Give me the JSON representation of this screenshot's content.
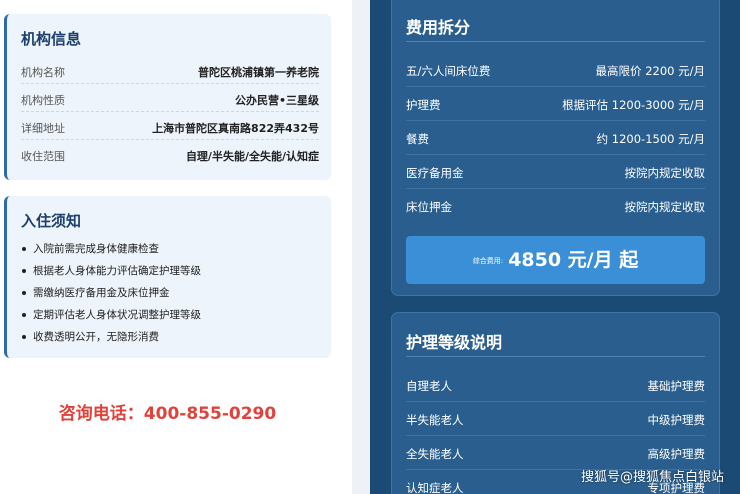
{
  "org_info": {
    "title": "机构信息",
    "rows": [
      {
        "label": "机构名称",
        "value": "普陀区桃浦镇第一养老院"
      },
      {
        "label": "机构性质",
        "value": "公办民营•三星级"
      },
      {
        "label": "详细地址",
        "value": "上海市普陀区真南路822弄432号"
      },
      {
        "label": "收住范围",
        "value": "自理/半失能/全失能/认知症"
      }
    ]
  },
  "notice": {
    "title": "入住须知",
    "items": [
      "入院前需完成身体健康检查",
      "根据老人身体能力评估确定护理等级",
      "需缴纳医疗备用金及床位押金",
      "定期评估老人身体状况调整护理等级",
      "收费透明公开，无隐形消费"
    ]
  },
  "hotline": "咨询电话：400-855-0290",
  "fees": {
    "title": "费用拆分",
    "rows": [
      {
        "label": "五/六人间床位费",
        "value": "最高限价 2200 元/月"
      },
      {
        "label": "护理费",
        "value": "根据评估 1200-3000 元/月"
      },
      {
        "label": "餐费",
        "value": "约 1200-1500 元/月"
      },
      {
        "label": "医疗备用金",
        "value": "按院内规定收取"
      },
      {
        "label": "床位押金",
        "value": "按院内规定收取"
      }
    ],
    "total_label": "综合费用:",
    "total_value": "4850 元/月 起"
  },
  "care_levels": {
    "title": "护理等级说明",
    "rows": [
      {
        "label": "自理老人",
        "value": "基础护理费"
      },
      {
        "label": "半失能老人",
        "value": "中级护理费"
      },
      {
        "label": "全失能老人",
        "value": "高级护理费"
      },
      {
        "label": "认知症老人",
        "value": "专项护理费"
      }
    ]
  },
  "watermark": "搜狐号@搜狐焦点白银站",
  "colors": {
    "accent": "#2c6aa8",
    "dark_panel": "#1b4a75",
    "hotline": "#e0433c",
    "total_bar": "#3a8fd6"
  }
}
